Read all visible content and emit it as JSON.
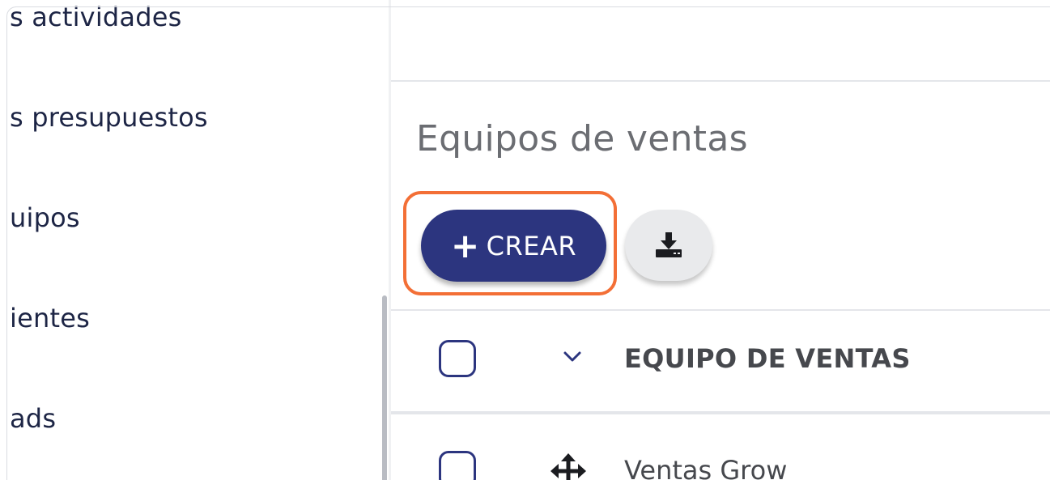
{
  "sidebar": {
    "items": [
      {
        "label": "s actividades"
      },
      {
        "label": "s presupuestos"
      },
      {
        "label": "uipos"
      },
      {
        "label": "ientes"
      },
      {
        "label": "ads"
      }
    ]
  },
  "main": {
    "title": "Equipos de ventas",
    "toolbar": {
      "create_label": "CREAR",
      "create_icon": "plus-icon",
      "download_icon": "download-icon",
      "highlight_color": "#f36f36",
      "primary_color": "#2c357f"
    },
    "table": {
      "columns": [
        {
          "label": "EQUIPO DE VENTAS"
        }
      ],
      "rows": [
        {
          "name": "Ventas Grow"
        }
      ]
    }
  }
}
